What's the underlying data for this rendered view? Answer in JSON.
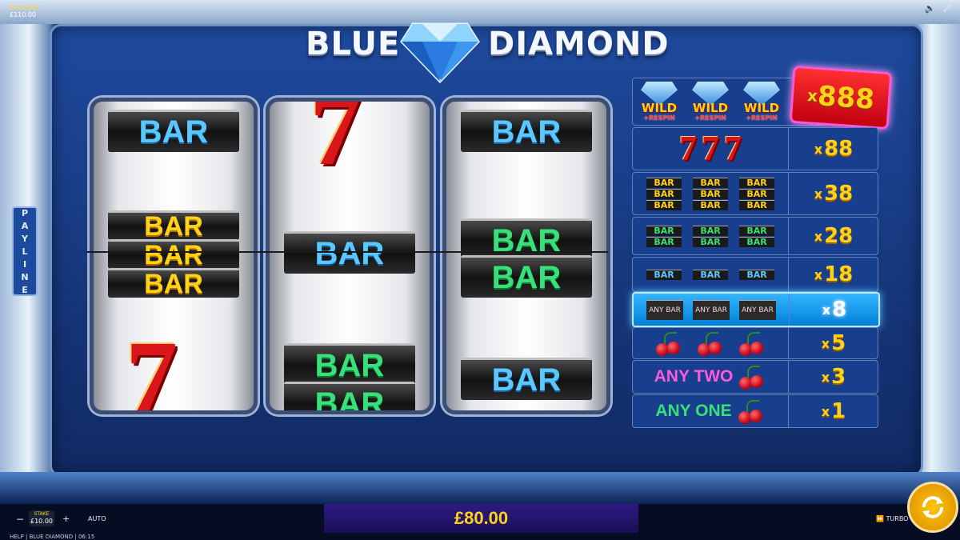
{
  "game": {
    "title_left": "BLUE",
    "title_right": "DIAMOND"
  },
  "top_bar": {
    "balance_label": "BALANCE",
    "balance_value": "£110.00",
    "icons": [
      "sound-icon",
      "fullscreen-icon"
    ]
  },
  "payline_label": [
    "P",
    "A",
    "Y",
    "L",
    "I",
    "N",
    "E"
  ],
  "reels": {
    "reel1": [
      "BAR",
      "BAR",
      "BAR",
      "BAR",
      "7"
    ],
    "reel2": [
      "7",
      "BAR",
      "BAR",
      "BAR"
    ],
    "reel3": [
      "BAR",
      "BAR",
      "BAR",
      "BAR"
    ]
  },
  "paytable": {
    "jackpot": {
      "x": "x",
      "value": "888"
    },
    "wild": {
      "word": "WILD",
      "respin": "+RESPIN"
    },
    "rows": [
      {
        "symbol": "777",
        "x": "x",
        "value": "88"
      },
      {
        "symbol": "triple-bar",
        "x": "x",
        "value": "38"
      },
      {
        "symbol": "double-bar",
        "x": "x",
        "value": "28"
      },
      {
        "symbol": "single-bar",
        "x": "x",
        "value": "18"
      },
      {
        "symbol": "any-bar",
        "any_bar_label": "ANY BAR",
        "x": "x",
        "value": "8"
      },
      {
        "symbol": "cherries",
        "x": "x",
        "value": "5"
      },
      {
        "symbol": "any-two-cherry",
        "label": "ANY TWO",
        "x": "x",
        "value": "3"
      },
      {
        "symbol": "any-one-cherry",
        "label": "ANY ONE",
        "x": "x",
        "value": "1"
      }
    ],
    "bar_word": "BAR",
    "seven": "7"
  },
  "hud": {
    "minus": "−",
    "plus": "+",
    "stake_label": "STAKE",
    "stake_value": "£10.00",
    "auto": "AUTO",
    "win": "£80.00",
    "turbo": "TURBO",
    "footer": "HELP | BLUE DIAMOND | 06:15"
  },
  "colors": {
    "accent": "#ffd21a",
    "panel": "#173f8e",
    "highlight": "#33b6ff"
  }
}
